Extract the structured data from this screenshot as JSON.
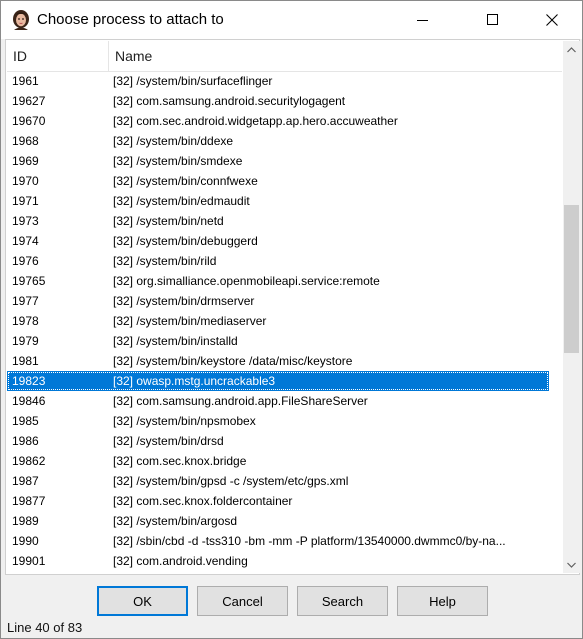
{
  "window": {
    "title": "Choose process to attach to"
  },
  "columns": {
    "id": "ID",
    "name": "Name"
  },
  "rows": [
    {
      "id": "1961",
      "name": "[32] /system/bin/surfaceflinger",
      "selected": false
    },
    {
      "id": "19627",
      "name": "[32] com.samsung.android.securitylogagent",
      "selected": false
    },
    {
      "id": "19670",
      "name": "[32] com.sec.android.widgetapp.ap.hero.accuweather",
      "selected": false
    },
    {
      "id": "1968",
      "name": "[32] /system/bin/ddexe",
      "selected": false
    },
    {
      "id": "1969",
      "name": "[32] /system/bin/smdexe",
      "selected": false
    },
    {
      "id": "1970",
      "name": "[32] /system/bin/connfwexe",
      "selected": false
    },
    {
      "id": "1971",
      "name": "[32] /system/bin/edmaudit",
      "selected": false
    },
    {
      "id": "1973",
      "name": "[32] /system/bin/netd",
      "selected": false
    },
    {
      "id": "1974",
      "name": "[32] /system/bin/debuggerd",
      "selected": false
    },
    {
      "id": "1976",
      "name": "[32] /system/bin/rild",
      "selected": false
    },
    {
      "id": "19765",
      "name": "[32] org.simalliance.openmobileapi.service:remote",
      "selected": false
    },
    {
      "id": "1977",
      "name": "[32] /system/bin/drmserver",
      "selected": false
    },
    {
      "id": "1978",
      "name": "[32] /system/bin/mediaserver",
      "selected": false
    },
    {
      "id": "1979",
      "name": "[32] /system/bin/installd",
      "selected": false
    },
    {
      "id": "1981",
      "name": "[32] /system/bin/keystore /data/misc/keystore",
      "selected": false
    },
    {
      "id": "19823",
      "name": "[32] owasp.mstg.uncrackable3",
      "selected": true
    },
    {
      "id": "19846",
      "name": "[32] com.samsung.android.app.FileShareServer",
      "selected": false
    },
    {
      "id": "1985",
      "name": "[32] /system/bin/npsmobex",
      "selected": false
    },
    {
      "id": "1986",
      "name": "[32] /system/bin/drsd",
      "selected": false
    },
    {
      "id": "19862",
      "name": "[32] com.sec.knox.bridge",
      "selected": false
    },
    {
      "id": "1987",
      "name": "[32] /system/bin/gpsd -c /system/etc/gps.xml",
      "selected": false
    },
    {
      "id": "19877",
      "name": "[32] com.sec.knox.foldercontainer",
      "selected": false
    },
    {
      "id": "1989",
      "name": "[32] /system/bin/argosd",
      "selected": false
    },
    {
      "id": "1990",
      "name": "[32] /sbin/cbd -d -tss310 -bm -mm -P platform/13540000.dwmmc0/by-na...",
      "selected": false
    },
    {
      "id": "19901",
      "name": "[32] com.android.vending",
      "selected": false
    }
  ],
  "buttons": {
    "ok": "OK",
    "cancel": "Cancel",
    "search": "Search",
    "help": "Help"
  },
  "status": "Line 40 of 83",
  "colors": {
    "selection": "#0078d7",
    "button_face": "#e1e1e1",
    "scroll_thumb": "#cdcdcd"
  },
  "icons": {
    "app": "app-avatar-icon",
    "minimize": "minimize-icon",
    "maximize": "maximize-icon",
    "close": "close-icon",
    "scroll_up": "chevron-up-icon",
    "scroll_down": "chevron-down-icon"
  }
}
